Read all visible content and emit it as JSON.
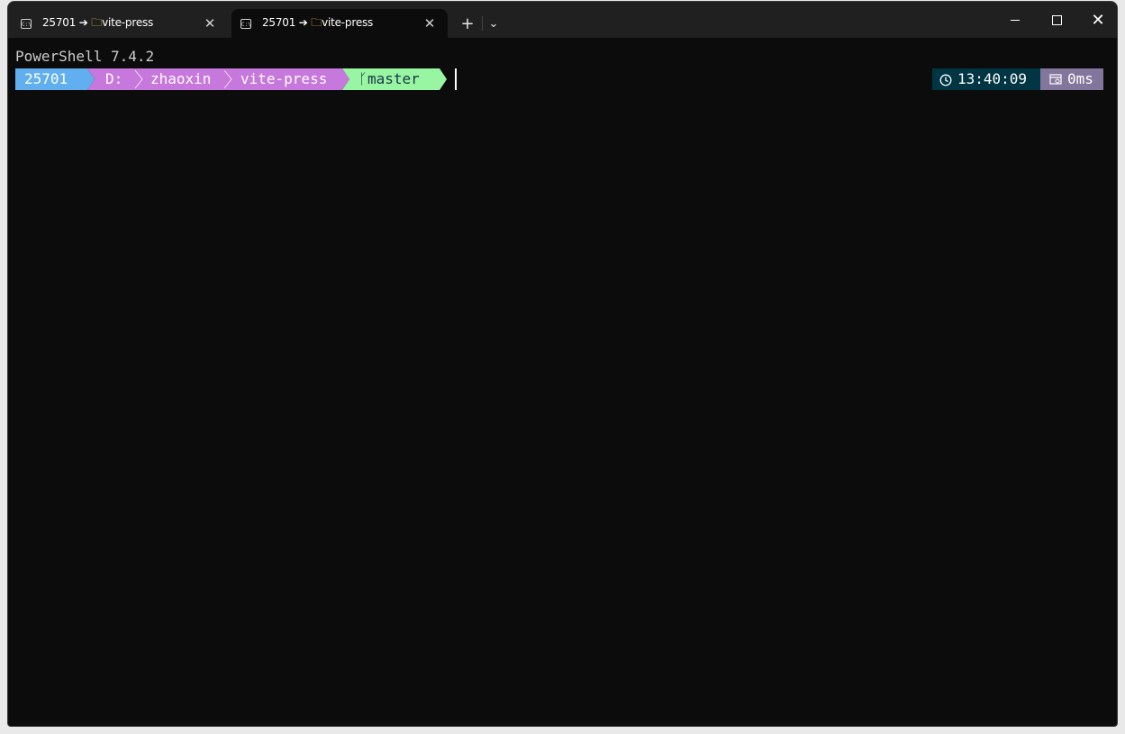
{
  "tabs": [
    {
      "icon": "C:\\",
      "title_prefix": "25701 ➔ ",
      "folder": "🗀",
      "title_suffix": "vite-press",
      "close": "✕"
    },
    {
      "icon": "C:\\",
      "title_prefix": "25701 ➔ ",
      "folder": "🗀",
      "title_suffix": "vite-press",
      "close": "✕"
    }
  ],
  "titlebar": {
    "new_tab": "+",
    "dropdown": "⌄",
    "close": "✕"
  },
  "terminal": {
    "banner": "PowerShell 7.4.2",
    "prompt": {
      "user": "25701",
      "drive": "D:",
      "dir1": "zhaoxin",
      "dir2": "vite-press",
      "branch_icon": "ᚴ",
      "branch": "master",
      "time": "13:40:09",
      "exec_time": "0ms"
    }
  },
  "colors": {
    "user_segment": "#61afef",
    "path_segment": "#c678dd",
    "git_segment": "#98f5a1",
    "time_segment": "#003543",
    "exec_segment": "#83769c",
    "background": "#0c0c0c"
  }
}
